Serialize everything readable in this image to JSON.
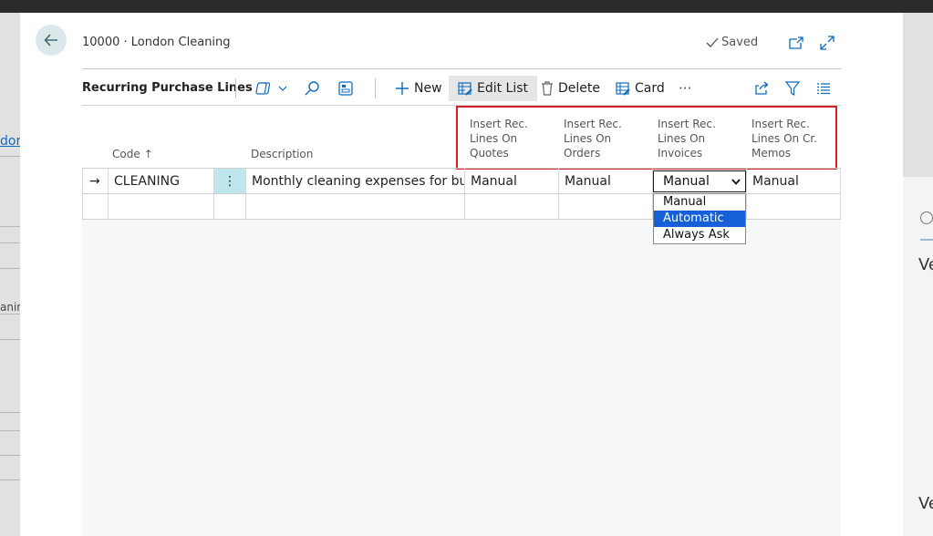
{
  "background": {
    "vendor_fragment": "dor",
    "cleaning_fragment": "anin",
    "right_fragment_1": "Ve",
    "right_fragment_2": "Ve"
  },
  "header": {
    "breadcrumb": "10000 · London Cleaning",
    "saved_label": "Saved"
  },
  "toolbar": {
    "title": "Recurring Purchase Lines",
    "new_label": "New",
    "edit_list_label": "Edit List",
    "delete_label": "Delete",
    "card_label": "Card",
    "more_label": "···"
  },
  "columns": {
    "code": "Code",
    "code_sort": "↑",
    "description": "Description",
    "quotes": [
      "Insert Rec.",
      "Lines On",
      "Quotes"
    ],
    "orders": [
      "Insert Rec.",
      "Lines On",
      "Orders"
    ],
    "invoices": [
      "Insert Rec.",
      "Lines On",
      "Invoices"
    ],
    "cr_memos": [
      "Insert Rec.",
      "Lines On Cr.",
      "Memos"
    ]
  },
  "rows": [
    {
      "indicator": "→",
      "code": "CLEANING",
      "menu": "⋮",
      "description": "Monthly cleaning expenses for buil...",
      "quotes": "Manual",
      "orders": "Manual",
      "invoices": "Manual",
      "cr_memos": "Manual"
    }
  ],
  "dropdown": {
    "options": [
      "Manual",
      "Automatic",
      "Always Ask"
    ],
    "highlighted": "Automatic"
  },
  "colors": {
    "accent": "#0f6cbd",
    "highlight_border": "#d0202a",
    "selected_option": "#1560d6",
    "menu_cell": "#bfe6ea"
  }
}
